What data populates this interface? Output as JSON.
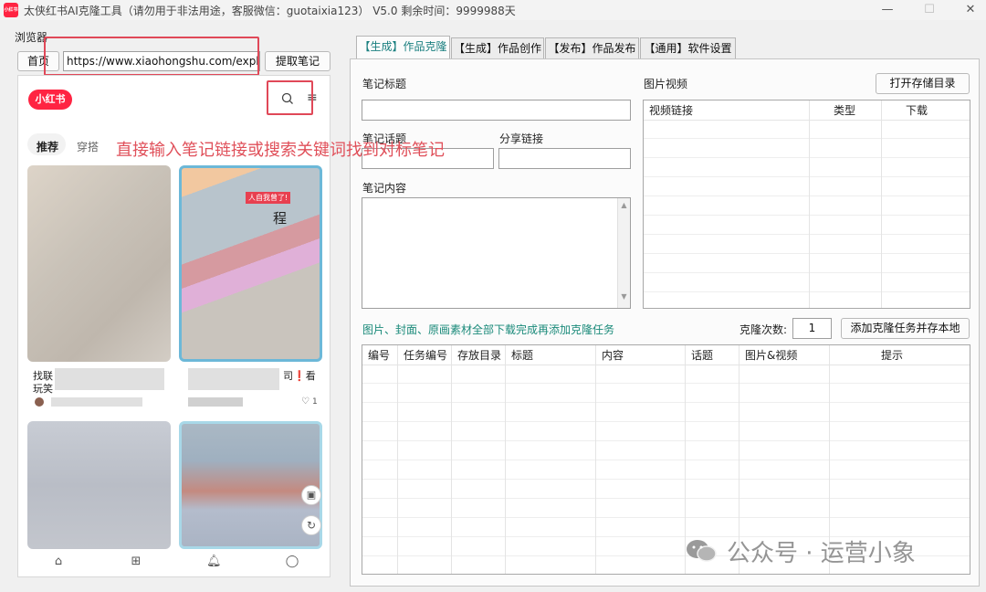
{
  "window": {
    "app_icon_text": "小红书",
    "title": "太侠红书AI克隆工具（请勿用于非法用途，客服微信：guotaixia123） V5.0 剩余时间：9999988天",
    "minimize": "—",
    "maximize": "☐",
    "close": "✕"
  },
  "browser": {
    "section_label": "浏览器",
    "home_label": "首页",
    "url_value": "https://www.xiaohongshu.com/explore",
    "fetch_label": "提取笔记",
    "logo_text": "小红书",
    "search_icon": "search-icon",
    "menu_icon": "≡",
    "categories": [
      "推荐",
      "穿搭"
    ],
    "overlay_annotation": "直接输入笔记链接或搜索关键词找到对标笔记",
    "card1_caption": "找联",
    "card1_caption2": "玩笑",
    "card2_caption": "司❗看",
    "like_count": "1",
    "card2_badge": "人自我曾了!",
    "card2_heading": "程"
  },
  "tabs": [
    {
      "label": "【生成】作品克隆",
      "active": true
    },
    {
      "label": "【生成】作品创作",
      "active": false
    },
    {
      "label": "【发布】作品发布",
      "active": false
    },
    {
      "label": "【通用】软件设置",
      "active": false
    }
  ],
  "clone_form": {
    "note_title_label": "笔记标题",
    "note_topic_label": "笔记话题",
    "share_link_label": "分享链接",
    "note_content_label": "笔记内容",
    "media_label": "图片视频",
    "open_dir_label": "打开存储目录",
    "media_columns": [
      "视频链接",
      "类型",
      "下载"
    ],
    "hint": "图片、封面、原画素材全部下载完成再添加克隆任务",
    "clone_count_label": "克隆次数:",
    "clone_count_value": "1",
    "add_task_label": "添加克隆任务并存本地",
    "task_columns": [
      "编号",
      "任务编号",
      "存放目录",
      "标题",
      "内容",
      "话题",
      "图片&视频",
      "提示"
    ]
  },
  "watermark": "公众号 · 运营小象",
  "colors": {
    "brand_red": "#ff2442",
    "hint_green": "#1a8a7a",
    "annotation_red": "#e0505a"
  }
}
